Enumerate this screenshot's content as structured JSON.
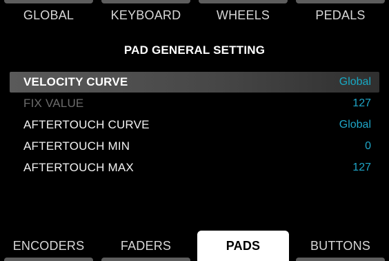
{
  "top_tabs": [
    "GLOBAL",
    "KEYBOARD",
    "WHEELS",
    "PEDALS"
  ],
  "title": "PAD GENERAL SETTING",
  "settings": [
    {
      "label": "VELOCITY CURVE",
      "value": "Global"
    },
    {
      "label": "FIX VALUE",
      "value": "127"
    },
    {
      "label": "AFTERTOUCH CURVE",
      "value": "Global"
    },
    {
      "label": "AFTERTOUCH MIN",
      "value": "0"
    },
    {
      "label": "AFTERTOUCH MAX",
      "value": "127"
    }
  ],
  "bottom_tabs": [
    "ENCODERS",
    "FADERS",
    "PADS",
    "BUTTONS"
  ],
  "active_bottom_tab": "PADS",
  "colors": {
    "background": "#000000",
    "value_accent": "#1fa6c8",
    "selected_row": "#4a4a4a",
    "disabled_text": "#6c6c6c",
    "active_tab_bg": "#ffffff"
  }
}
